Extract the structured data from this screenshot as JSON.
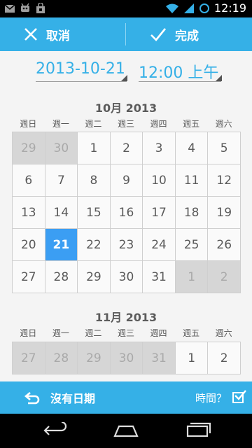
{
  "status_bar": {
    "time": "12:19",
    "icons": [
      "gmail-icon",
      "android-debug-icon",
      "shopping-bag-icon",
      "wifi-icon",
      "signal-icon",
      "battery-icon"
    ]
  },
  "action_bar": {
    "cancel_label": "取消",
    "done_label": "完成",
    "color": "#35b0e7"
  },
  "picker": {
    "date": "2013-10-21",
    "time": "12:00 上午"
  },
  "weekdays": [
    "週日",
    "週一",
    "週二",
    "週三",
    "週四",
    "週五",
    "週六"
  ],
  "calendar": [
    {
      "title": "10月 2013",
      "weeks": [
        [
          {
            "d": "29",
            "out": true
          },
          {
            "d": "30",
            "out": true
          },
          {
            "d": "1"
          },
          {
            "d": "2"
          },
          {
            "d": "3"
          },
          {
            "d": "4"
          },
          {
            "d": "5"
          }
        ],
        [
          {
            "d": "6"
          },
          {
            "d": "7"
          },
          {
            "d": "8"
          },
          {
            "d": "9"
          },
          {
            "d": "10"
          },
          {
            "d": "11"
          },
          {
            "d": "12"
          }
        ],
        [
          {
            "d": "13"
          },
          {
            "d": "14"
          },
          {
            "d": "15"
          },
          {
            "d": "16"
          },
          {
            "d": "17"
          },
          {
            "d": "18"
          },
          {
            "d": "19"
          }
        ],
        [
          {
            "d": "20"
          },
          {
            "d": "21",
            "selected": true
          },
          {
            "d": "22"
          },
          {
            "d": "23"
          },
          {
            "d": "24"
          },
          {
            "d": "25"
          },
          {
            "d": "26"
          }
        ],
        [
          {
            "d": "27"
          },
          {
            "d": "28"
          },
          {
            "d": "29"
          },
          {
            "d": "30"
          },
          {
            "d": "31"
          },
          {
            "d": "1",
            "out": true
          },
          {
            "d": "2",
            "out": true
          }
        ]
      ]
    },
    {
      "title": "11月 2013",
      "weeks": [
        [
          {
            "d": "27",
            "out": true
          },
          {
            "d": "28",
            "out": true
          },
          {
            "d": "29",
            "out": true
          },
          {
            "d": "30",
            "out": true
          },
          {
            "d": "31",
            "out": true
          },
          {
            "d": "1"
          },
          {
            "d": "2"
          }
        ]
      ]
    }
  ],
  "bottom_bar": {
    "no_date_label": "沒有日期",
    "time_label": "時間？",
    "time_checked": true
  },
  "colors": {
    "accent": "#35b0e7",
    "selected": "#3b9ef3",
    "out_of_month": "#d6d6d6"
  }
}
